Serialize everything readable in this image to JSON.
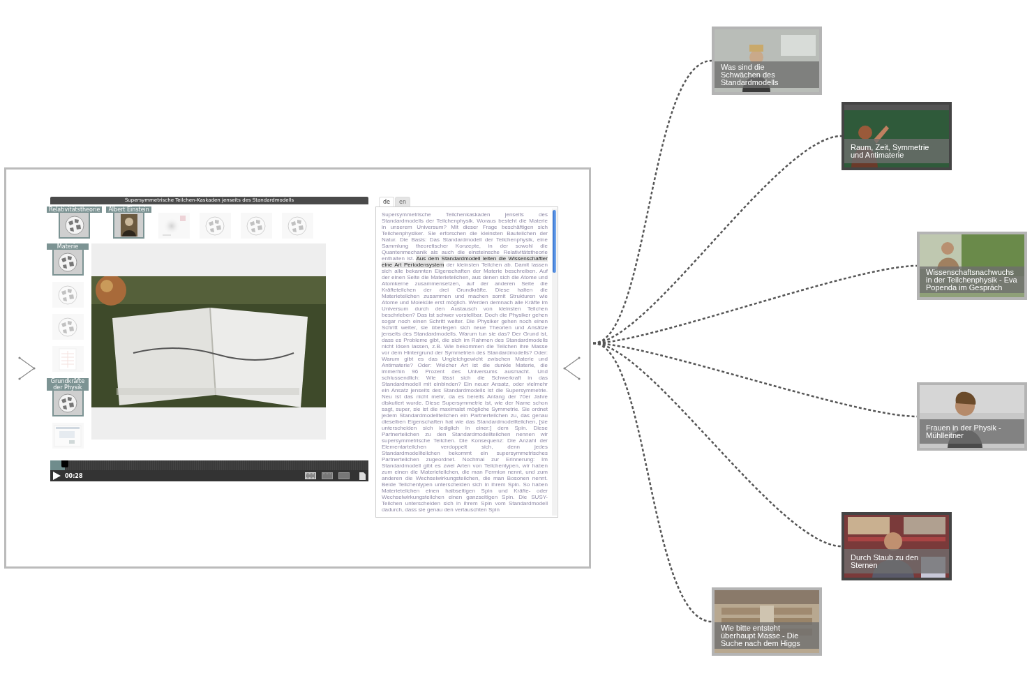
{
  "player": {
    "title": "Supersymmetrische Teilchen-Kaskaden jenseits des Standardmodells",
    "thumbnails_top": [
      {
        "label": "Relativitätstheorie",
        "kind": "wiki",
        "active": true
      },
      {
        "label": "Albert Einstein",
        "kind": "portrait",
        "active": true
      },
      {
        "kind": "blur",
        "active": false
      },
      {
        "kind": "wiki",
        "active": false
      },
      {
        "kind": "wiki",
        "active": false
      },
      {
        "kind": "wiki",
        "active": false
      }
    ],
    "thumbnails_side": [
      {
        "label": "Materie",
        "kind": "wiki",
        "active": true
      },
      {
        "kind": "wiki",
        "active": false
      },
      {
        "kind": "wiki",
        "active": false
      },
      {
        "kind": "diagram",
        "active": false
      },
      {
        "label": "Grundkräfte der Physik",
        "kind": "wiki",
        "active": true
      },
      {
        "kind": "screenshot",
        "active": false
      }
    ],
    "progress": {
      "level": 0.045
    },
    "time": "00:28"
  },
  "transcript": {
    "tabs": [
      {
        "label": "de",
        "selected": true
      },
      {
        "label": "en",
        "selected": false
      }
    ],
    "segments": [
      {
        "text": "Supersymmetrische Teilchenkaskaden jenseits des Standardmodells der Teilchenphysik. Woraus besteht die Materie in unserem Universum? Mit dieser Frage beschäftigen sich Teilchenphysiker. Sie erforschen die kleinsten Bauteilchen der Natur. Die Basis: Das Standardmodell der Teilchenphysik, eine Sammlung theoretischer Konzepte, in der sowohl die Quantenmechanik als auch die einsteinsche Relativitätstheorie enthalten ist. ",
        "highlighted": false
      },
      {
        "text": "Aus dem Standardmodell leiten die Wissenschaftler eine Art Periodensystem",
        "highlighted": true
      },
      {
        "text": " der kleinsten Teilchen ab. Damit lassen sich alle bekannten Eigenschaften der Materie beschreiben. Auf der einen Seite die Materieteilchen, aus denen sich die Atome und Atomkerne zusammensetzen, auf der anderen Seite die Kräfteteilchen der drei Grundkräfte. Diese halten die Materieteilchen zusammen und machen somit Strukturen wie Atome und Moleküle erst möglich. Werden demnach alle Kräfte im Universum durch den Austausch von kleinsten Teilchen beschrieben? Das ist schwer vorstellbar. Doch die Physiker gehen sogar noch einen Schritt weiter. Die Physiker gehen noch einen Schritt weiter, sie überlegen sich neue Theorien und Ansätze jenseits des Standardmodells. Warum tun sie das? Der Grund ist, dass es Probleme gibt, die sich im Rahmen des Standardmodells nicht lösen lassen, z.B. Wie bekommen die Teilchen ihre Masse vor dem Hintergrund der Symmetrien des Standardmodells? Oder: Warum gibt es das Ungleichgewicht zwischen Materie und Antimaterie? Oder: Welcher Art ist die dunkle Materie, die immerhin 96 Prozent des Universums ausmacht. Und schlussendlich: Wie lässt sich die Schwerkraft in das Standardmodell mit einbinden? Ein neuer Ansatz, oder vielmehr ein Ansatz jenseits des Standardmodells ist die Supersymmetrie. Neu ist das nicht mehr, da es bereits Anfang der 70er Jahre diskutiert wurde. Diese Supersymmetrie ist, wie der Name schon sagt, super, sie ist die maximalst mögliche Symmetrie. Sie ordnet jedem Standardmodellteilchen ein Partnerteilchen zu, das genau dieselben Eigenschaften hat wie das Standardmodellteilchen, [sie unterscheiden sich lediglich in einer:] dem Spin. Diese Partnerteilchen zu den Standardmodellteilchen nennen wir supersymmetrische Teilchen. Die Konsequenz: Die Anzahl der Elementarteilchen verdoppelt sich, denn jedes Standardmodellteilchen bekommt ein supersymmetrisches Partnerteilchen zugeordnet. Nochmal zur Erinnerung: Im Standardmodell gibt es zwei Arten von Teilchentypen, wir haben zum einen die Materieteilchen, die man Fermion nennt, und zum anderen die Wechselwirkungsteilchen, die man Bosonen nennt. Beide Teilchentypen unterscheiden sich in ihrem Spin. So haben Materieteilchen einen halbseitigen Spin und Kräfte- oder Wechselwirkungsteilchen einen ganzseitigen Spin. Die SUSY-Teilchen unterscheiden sich in ihrem Spin vom Standardmodell dadurch, dass sie genau den vertauschten Spin",
        "highlighted": false
      }
    ]
  },
  "related_videos": [
    {
      "title": "Was sind die Schwächen des Standardmodells",
      "selected": false
    },
    {
      "title": "Raum, Zeit, Symmetrie und Antimaterie",
      "selected": true
    },
    {
      "title": "Wissenschaftsnachwuchs in der Teilchenphysik - Eva Popenda im Gespräch",
      "selected": false
    },
    {
      "title": "Frauen in der Physik - Mühlleitner",
      "selected": false
    },
    {
      "title": "Durch Staub zu den Sternen",
      "selected": true
    },
    {
      "title": "Wie bitte entsteht überhaupt Masse - Die Suche nach dem Higgs",
      "selected": false
    }
  ]
}
